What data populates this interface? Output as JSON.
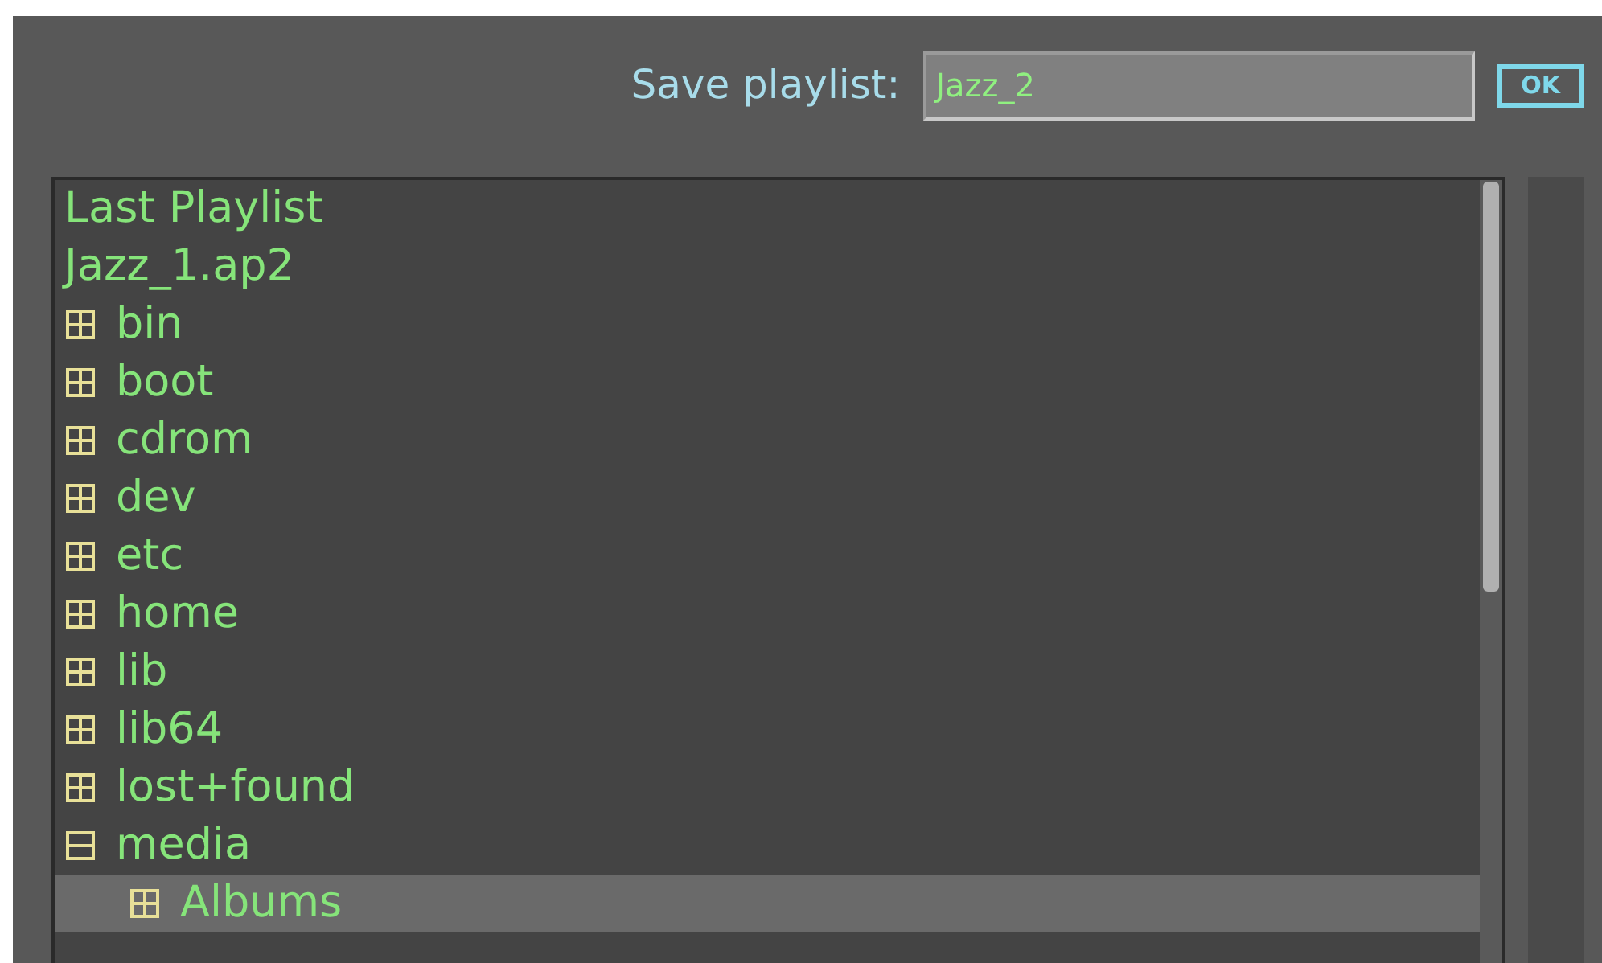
{
  "save_bar": {
    "label": "Save playlist:",
    "value": "Jazz_2",
    "ok_button": "OK"
  },
  "tree": [
    {
      "label": "Last Playlist",
      "kind": "entry",
      "selected": false
    },
    {
      "label": "Jazz_1.ap2",
      "kind": "entry",
      "selected": false
    },
    {
      "label": "bin",
      "kind": "folder",
      "expanded": false,
      "selected": false
    },
    {
      "label": "boot",
      "kind": "folder",
      "expanded": false,
      "selected": false
    },
    {
      "label": "cdrom",
      "kind": "folder",
      "expanded": false,
      "selected": false
    },
    {
      "label": "dev",
      "kind": "folder",
      "expanded": false,
      "selected": false
    },
    {
      "label": "etc",
      "kind": "folder",
      "expanded": false,
      "selected": false
    },
    {
      "label": "home",
      "kind": "folder",
      "expanded": false,
      "selected": false
    },
    {
      "label": "lib",
      "kind": "folder",
      "expanded": false,
      "selected": false
    },
    {
      "label": "lib64",
      "kind": "folder",
      "expanded": false,
      "selected": false
    },
    {
      "label": "lost+found",
      "kind": "folder",
      "expanded": false,
      "selected": false
    },
    {
      "label": "media",
      "kind": "folder",
      "expanded": true,
      "selected": false,
      "children": [
        {
          "label": "Albums",
          "kind": "folder",
          "expanded": false,
          "selected": true
        }
      ]
    }
  ]
}
